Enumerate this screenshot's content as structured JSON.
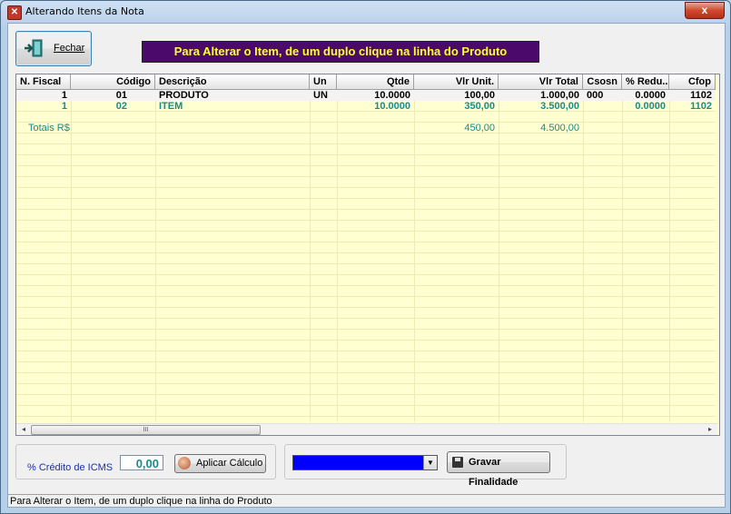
{
  "window": {
    "title": "Alterando Itens da Nota",
    "close_glyph": "x"
  },
  "toolbar": {
    "fechar_label": "Fechar",
    "fechar_icon": "exit-door-icon"
  },
  "banner": {
    "text": "Para Alterar o Item, de um duplo clique na linha do Produto",
    "bg": "#4b0a6b",
    "fg": "#ffff33"
  },
  "grid": {
    "columns": [
      "N. Fiscal",
      "Código",
      "Descrição",
      "Un",
      "Qtde",
      "Vlr Unit.",
      "Vlr Total",
      "Csosn",
      "% Redu...",
      "Cfop"
    ],
    "rows": [
      [
        "1",
        "01",
        "PRODUTO",
        "UN",
        "10.0000",
        "100,00",
        "1.000,00",
        "000",
        "0.0000",
        "1102"
      ],
      [
        "1",
        "02",
        "ITEM",
        "",
        "10.0000",
        "350,00",
        "3.500,00",
        "",
        "0.0000",
        "1102"
      ]
    ],
    "totals": {
      "label": "Totais R$",
      "vlr_unit": "450,00",
      "vlr_total": "4.500,00"
    },
    "scroll_thumb_glyph": "III",
    "left_arrow": "◂",
    "right_arrow": "▸"
  },
  "icms": {
    "label": "% Crédito de ICMS",
    "value": "0,00",
    "apply_label": "Aplicar Cálculo"
  },
  "finalidade": {
    "combo_color": "#0000ff",
    "dropdown_glyph": "▼",
    "save_label": "Gravar Finalidade"
  },
  "statusbar": {
    "text": "Para Alterar o Item, de um duplo clique na linha do Produto"
  },
  "colors": {
    "grid_bg": "#ffffd1",
    "teal_text": "#1a8a8a",
    "icms_label": "#1b2fa0"
  }
}
